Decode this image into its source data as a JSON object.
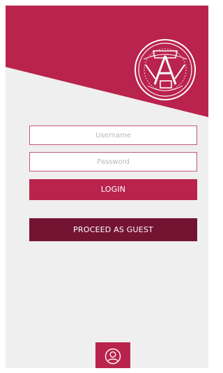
{
  "login_form": {
    "username_placeholder": "Username",
    "password_placeholder": "Password",
    "login_label": "LOGIN",
    "guest_label": "PROCEED AS GUEST"
  },
  "icons": {
    "seal": "university-seal-icon",
    "profile": "user-icon"
  },
  "colors": {
    "primary": "#b9234c",
    "dark": "#741433",
    "background": "#efefef",
    "header": "#b9234c"
  }
}
